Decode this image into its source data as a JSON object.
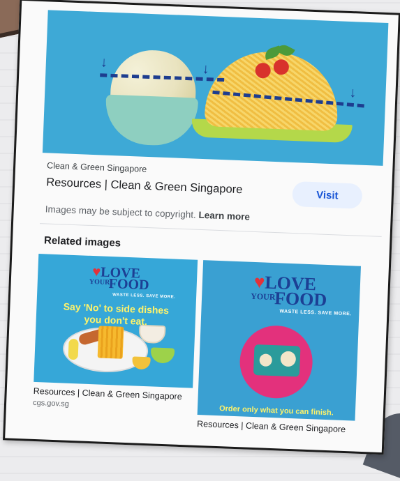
{
  "result": {
    "source": "Clean & Green Singapore",
    "title": "Resources | Clean & Green Singapore",
    "visit_label": "Visit",
    "copyright_text": "Images may be subject to copyright.",
    "learn_more_label": "Learn more"
  },
  "related": {
    "heading": "Related images",
    "items": [
      {
        "logo_love": "LOVE",
        "logo_your": "YOUR",
        "logo_food": "FOOD",
        "logo_sub": "WASTE LESS. SAVE MORE.",
        "tagline_1": "Say 'No' to side dishes",
        "tagline_2": "you don't eat.",
        "caption": "Resources | Clean & Green Singapore",
        "domain": "cgs.gov.sg"
      },
      {
        "logo_love": "LOVE",
        "logo_your": "YOUR",
        "logo_food": "FOOD",
        "logo_sub": "WASTE LESS. SAVE MORE.",
        "tagline": "Order only what you can finish.",
        "caption": "Resources | Clean & Green Singapore"
      }
    ]
  },
  "colors": {
    "visit_bg": "#e8f0fe",
    "visit_text": "#1a56d6",
    "hero_bg": "#3ea9d6",
    "thumb_bg": "#36a7d8",
    "tagline": "#fff36a"
  }
}
